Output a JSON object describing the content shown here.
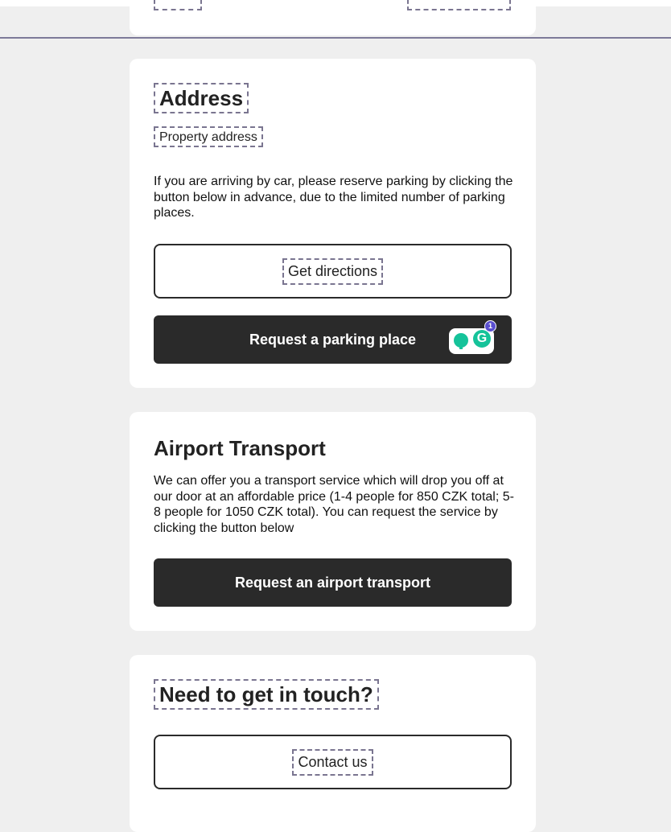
{
  "address": {
    "heading": "Address",
    "subheading": "Property address",
    "paragraph": "If you are arriving by car, please reserve parking by clicking the button below in advance, due to the limited number of parking places.",
    "directions_label": "Get directions",
    "parking_label": "Request a parking place"
  },
  "airport": {
    "heading": "Airport Transport",
    "paragraph": "We can offer you a transport service which will drop you off at our door at an affordable price (1-4 people for 850 CZK total; 5-8 people for 1050 CZK total). You can request the service by clicking the button below",
    "button_label": "Request an airport transport"
  },
  "contact": {
    "heading": "Need to get in touch?",
    "button_label": "Contact us"
  },
  "grammarly": {
    "badge_count": "1"
  }
}
